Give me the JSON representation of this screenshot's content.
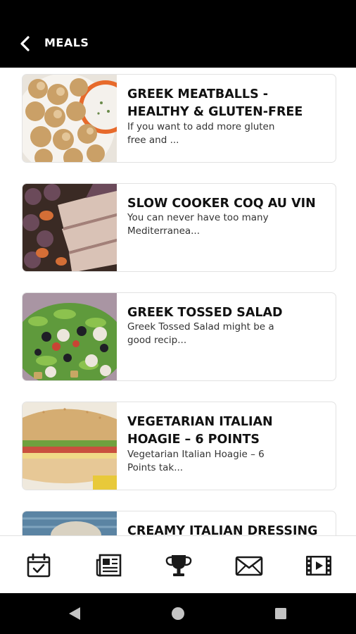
{
  "header": {
    "title": "MEALS",
    "back_icon": "chevron-left-icon"
  },
  "meals": [
    {
      "title": "GREEK MEATBALLS - HEALTHY & GLUTEN-FREE",
      "description": "If you want to add more gluten free and ..."
    },
    {
      "title": "SLOW COOKER COQ AU VIN",
      "description": "You can never have too many Mediterranea..."
    },
    {
      "title": "GREEK TOSSED SALAD",
      "description": "Greek Tossed Salad might be a good recip..."
    },
    {
      "title": "VEGETARIAN ITALIAN HOAGIE – 6 POINTS",
      "description": "Vegetarian Italian Hoagie – 6 Points tak..."
    },
    {
      "title": "CREAMY ITALIAN DRESSING",
      "description": ""
    }
  ],
  "bottom_nav": [
    {
      "icon": "calendar-check-icon"
    },
    {
      "icon": "newspaper-icon"
    },
    {
      "icon": "trophy-icon"
    },
    {
      "icon": "envelope-icon"
    },
    {
      "icon": "film-icon"
    }
  ],
  "system_nav": [
    "back-triangle-icon",
    "home-circle-icon",
    "recents-square-icon"
  ],
  "colors": {
    "app_bar": "#000000",
    "text": "#111111",
    "card_border": "#e2e2e2",
    "icon": "#1a1a1a"
  }
}
